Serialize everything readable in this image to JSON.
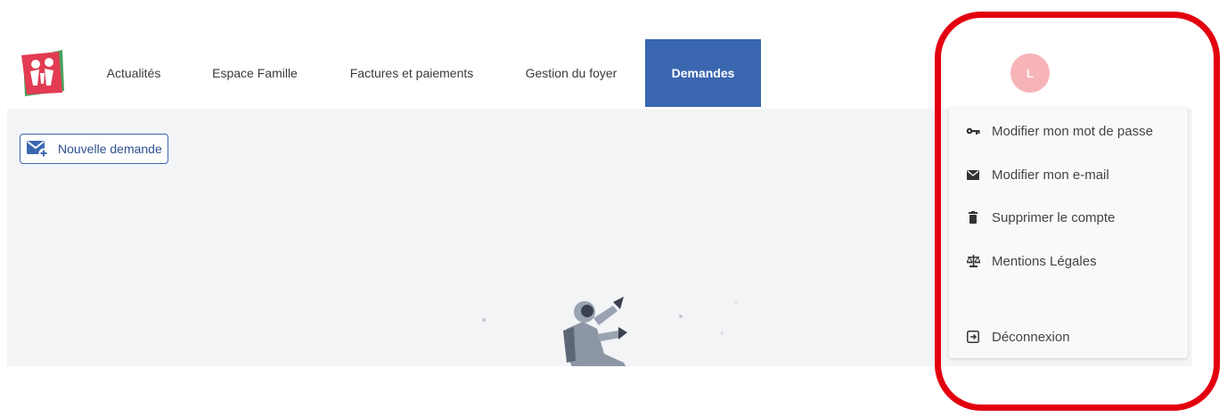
{
  "nav": {
    "items": [
      {
        "label": "Actualités"
      },
      {
        "label": "Espace Famille"
      },
      {
        "label": "Factures et paiements"
      },
      {
        "label": "Gestion du foyer"
      },
      {
        "label": "Demandes",
        "active": true
      }
    ]
  },
  "user": {
    "avatar_initial": "L",
    "avatar_color": "#f6b4b9"
  },
  "main": {
    "new_request_label": "Nouvelle demande"
  },
  "user_menu": {
    "items": [
      {
        "label": "Modifier mon mot de passe",
        "icon": "key-icon"
      },
      {
        "label": "Modifier mon e-mail",
        "icon": "envelope-icon"
      },
      {
        "label": "Supprimer le compte",
        "icon": "trash-icon"
      },
      {
        "label": "Mentions Légales",
        "icon": "scale-icon"
      },
      {
        "label": "Déconnexion",
        "icon": "logout-icon"
      }
    ]
  },
  "colors": {
    "accent": "#3b66b0",
    "annotation": "#e3000f",
    "content_bg": "#f3f4f6"
  }
}
